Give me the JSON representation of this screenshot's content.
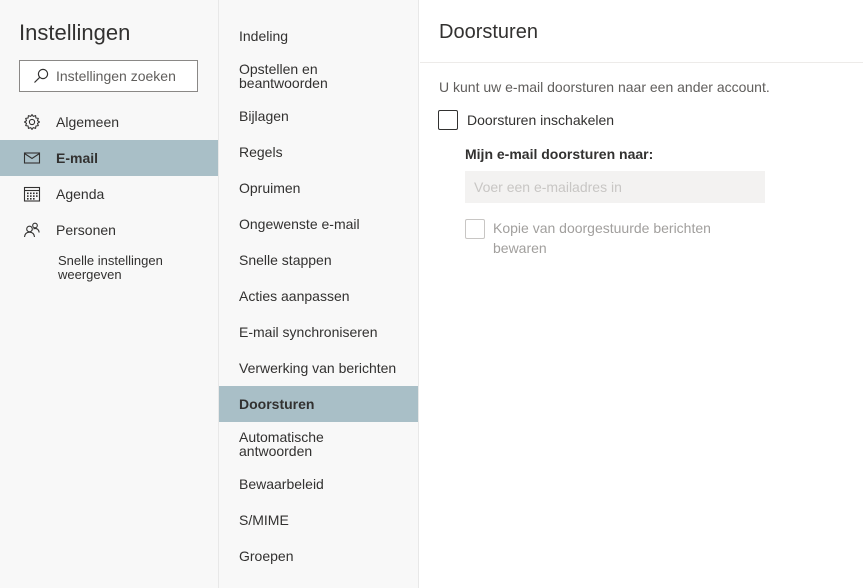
{
  "settings": {
    "title": "Instellingen",
    "search_placeholder": "Instellingen zoeken",
    "nav": [
      {
        "label": "Algemeen",
        "icon": "gear-icon"
      },
      {
        "label": "E-mail",
        "icon": "mail-icon",
        "active": true
      },
      {
        "label": "Agenda",
        "icon": "calendar-icon"
      },
      {
        "label": "Personen",
        "icon": "people-icon"
      }
    ],
    "quick_settings": "Snelle instellingen weergeven"
  },
  "mail_menu": {
    "items": [
      "Indeling",
      "Opstellen en beantwoorden",
      "Bijlagen",
      "Regels",
      "Opruimen",
      "Ongewenste e-mail",
      "Snelle stappen",
      "Acties aanpassen",
      "E-mail synchroniseren",
      "Verwerking van berichten",
      "Doorsturen",
      "Automatische antwoorden",
      "Bewaarbeleid",
      "S/MIME",
      "Groepen"
    ],
    "active": "Doorsturen"
  },
  "forwarding": {
    "title": "Doorsturen",
    "description": "U kunt uw e-mail doorsturen naar een ander account.",
    "enable_label": "Doorsturen inschakelen",
    "enabled": false,
    "forward_to_label": "Mijn e-mail doorsturen naar:",
    "email_placeholder": "Voer een e-mailadres in",
    "keep_copy_label": "Kopie van doorgestuurde berichten bewaren",
    "keep_copy_enabled": false
  },
  "colors": {
    "selection": "#a9bfc7",
    "sidebar_bg": "#f8f8f8",
    "text": "#323130",
    "muted": "#605e5c",
    "disabled": "#a19f9d"
  }
}
